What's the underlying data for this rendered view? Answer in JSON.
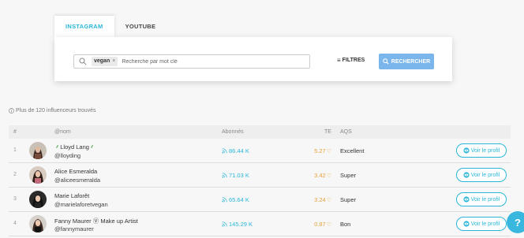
{
  "tabs": [
    {
      "label": "INSTAGRAM",
      "active": true
    },
    {
      "label": "YOUTUBE",
      "active": false
    }
  ],
  "search": {
    "chip": "vegan",
    "chip_remove": "×",
    "placeholder": "Recherche par mot clé",
    "filters_label": "FILTRES",
    "search_button": "RECHERCHER"
  },
  "results": {
    "count_text": "Plus de 120 influenceurs trouvés"
  },
  "table": {
    "headers": {
      "num": "#",
      "name": "@nom",
      "followers": "Abonnés",
      "te": "TE",
      "aqs": "AQS"
    },
    "profile_button": "Voir le profil",
    "rows": [
      {
        "num": "1",
        "name": "Lloyd Lang",
        "leaf_before": "⸙",
        "leaf_after": "⸙",
        "handle": "@lloyding",
        "followers": "86.44 K",
        "te": "5.27",
        "aqs": "Excellent"
      },
      {
        "num": "2",
        "name": "Alice Esmeralda",
        "handle": "@aliceesmeralda",
        "followers": "71.03 K",
        "te": "3.42",
        "aqs": "Super"
      },
      {
        "num": "3",
        "name": "Marie Laforêt",
        "handle": "@marielaforetvegan",
        "followers": "65.64 K",
        "te": "3.24",
        "aqs": "Super"
      },
      {
        "num": "4",
        "name": "Fanny Maurer Ⓥ Make up Artist",
        "handle": "@fannymaurer",
        "followers": "145.29 K",
        "te": "0.87",
        "aqs": "Bon"
      }
    ]
  },
  "help": {
    "label": "?"
  },
  "colors": {
    "accent": "#2ab6d9",
    "button": "#7ab6ec",
    "te": "#e4a23a",
    "leaf": "#3a9a3a"
  }
}
